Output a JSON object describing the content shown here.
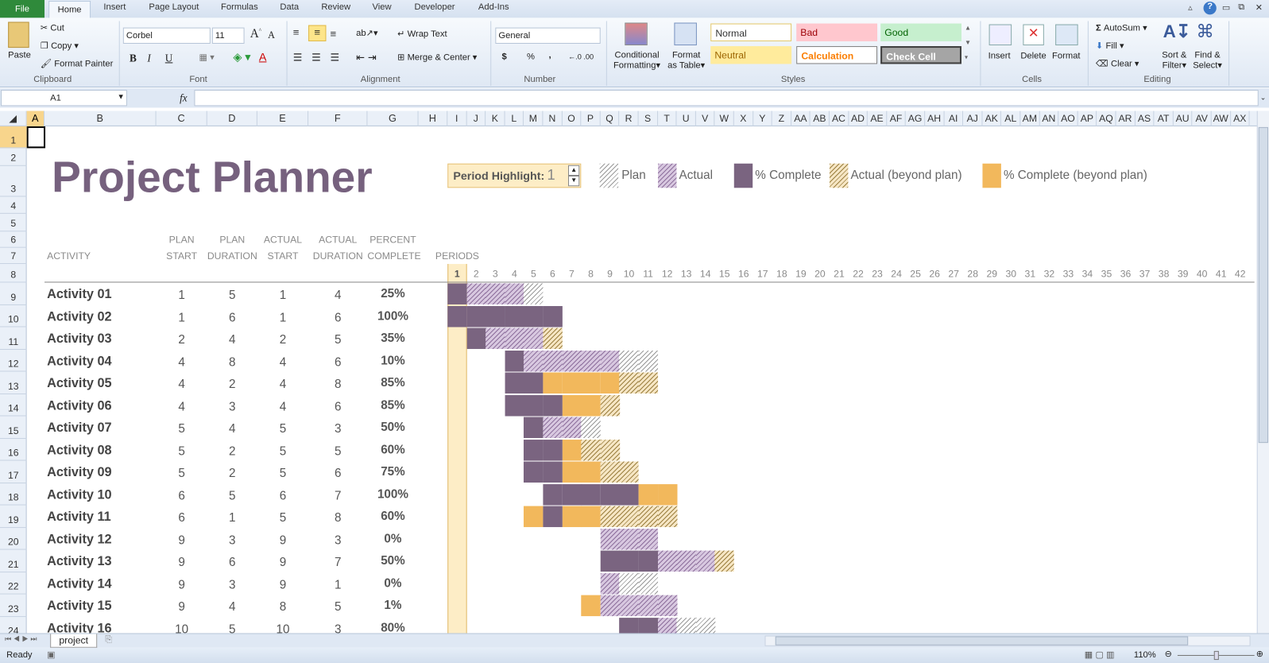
{
  "ribbon": {
    "file_tab": "File",
    "tabs": [
      "Home",
      "Insert",
      "Page Layout",
      "Formulas",
      "Data",
      "Review",
      "View",
      "Developer",
      "Add-Ins"
    ],
    "clipboard": {
      "paste": "Paste",
      "cut": "Cut",
      "copy": "Copy",
      "format_painter": "Format Painter",
      "group": "Clipboard"
    },
    "font": {
      "name": "Corbel",
      "size": "11",
      "group": "Font",
      "bold": "B",
      "italic": "I",
      "underline": "U"
    },
    "alignment": {
      "wrap": "Wrap Text",
      "merge": "Merge & Center",
      "group": "Alignment"
    },
    "number": {
      "format": "General",
      "currency": "$",
      "percent": "%",
      "comma": ",",
      "group": "Number"
    },
    "styles": {
      "conditional": "Conditional",
      "conditional2": "Formatting",
      "format_table": "Format",
      "format_table2": "as Table",
      "group": "Styles",
      "cells": [
        {
          "label": "Normal",
          "bg": "#ffffff",
          "fg": "#333333"
        },
        {
          "label": "Bad",
          "bg": "#ffc7ce",
          "fg": "#9c0006"
        },
        {
          "label": "Good",
          "bg": "#c6efce",
          "fg": "#006100"
        },
        {
          "label": "Neutral",
          "bg": "#ffeb9c",
          "fg": "#9c6500"
        },
        {
          "label": "Calculation",
          "bg": "#ffffff",
          "fg": "#fa7d00"
        },
        {
          "label": "Check Cell",
          "bg": "#a5a5a5",
          "fg": "#ffffff"
        }
      ]
    },
    "cells": {
      "insert": "Insert",
      "delete": "Delete",
      "format": "Format",
      "group": "Cells"
    },
    "editing": {
      "autosum": "AutoSum",
      "fill": "Fill",
      "clear": "Clear",
      "sort": "Sort &",
      "sort2": "Filter",
      "find": "Find &",
      "find2": "Select",
      "group": "Editing"
    }
  },
  "formula_bar": {
    "name_box": "A1",
    "fx": "fx",
    "formula": ""
  },
  "columns_left": [
    "A",
    "B",
    "C",
    "D",
    "E",
    "F",
    "G",
    "H"
  ],
  "columns_periods": [
    "I",
    "J",
    "K",
    "L",
    "M",
    "N",
    "O",
    "P",
    "Q",
    "R",
    "S",
    "T",
    "U",
    "V",
    "W",
    "X",
    "Y",
    "Z",
    "AA",
    "AB",
    "AC",
    "AD",
    "AE",
    "AF",
    "AG",
    "AH",
    "AI",
    "AJ",
    "AK",
    "AL",
    "AM",
    "AN",
    "AO",
    "AP",
    "AQ",
    "AR",
    "AS",
    "AT",
    "AU",
    "AV",
    "AW",
    "AX"
  ],
  "rows": [
    "1",
    "2",
    "3",
    "4",
    "5",
    "6",
    "7",
    "8",
    "9",
    "10",
    "11",
    "12",
    "13",
    "14",
    "15",
    "16",
    "17",
    "18",
    "19",
    "20",
    "21",
    "22",
    "23",
    "24"
  ],
  "sheet": {
    "title": "Project Planner",
    "period_highlight_label": "Period Highlight:",
    "period_highlight": 1,
    "legend": [
      "Plan",
      "Actual",
      "% Complete",
      "Actual (beyond plan)",
      "% Complete (beyond plan)"
    ],
    "headers": {
      "activity": "ACTIVITY",
      "plan_start": [
        "PLAN",
        "START"
      ],
      "plan_duration": [
        "PLAN",
        "DURATION"
      ],
      "actual_start": [
        "ACTUAL",
        "START"
      ],
      "actual_duration": [
        "ACTUAL",
        "DURATION"
      ],
      "percent_complete": [
        "PERCENT",
        "COMPLETE"
      ],
      "periods": "PERIODS"
    },
    "periods": [
      1,
      2,
      3,
      4,
      5,
      6,
      7,
      8,
      9,
      10,
      11,
      12,
      13,
      14,
      15,
      16,
      17,
      18,
      19,
      20,
      21,
      22,
      23,
      24,
      25,
      26,
      27,
      28,
      29,
      30,
      31,
      32,
      33,
      34,
      35,
      36,
      37,
      38,
      39,
      40,
      41,
      42
    ],
    "activities": [
      {
        "name": "Activity 01",
        "plan_start": 1,
        "plan_duration": 5,
        "actual_start": 1,
        "actual_duration": 4,
        "percent": "25%"
      },
      {
        "name": "Activity 02",
        "plan_start": 1,
        "plan_duration": 6,
        "actual_start": 1,
        "actual_duration": 6,
        "percent": "100%"
      },
      {
        "name": "Activity 03",
        "plan_start": 2,
        "plan_duration": 4,
        "actual_start": 2,
        "actual_duration": 5,
        "percent": "35%"
      },
      {
        "name": "Activity 04",
        "plan_start": 4,
        "plan_duration": 8,
        "actual_start": 4,
        "actual_duration": 6,
        "percent": "10%"
      },
      {
        "name": "Activity 05",
        "plan_start": 4,
        "plan_duration": 2,
        "actual_start": 4,
        "actual_duration": 8,
        "percent": "85%"
      },
      {
        "name": "Activity 06",
        "plan_start": 4,
        "plan_duration": 3,
        "actual_start": 4,
        "actual_duration": 6,
        "percent": "85%"
      },
      {
        "name": "Activity 07",
        "plan_start": 5,
        "plan_duration": 4,
        "actual_start": 5,
        "actual_duration": 3,
        "percent": "50%"
      },
      {
        "name": "Activity 08",
        "plan_start": 5,
        "plan_duration": 2,
        "actual_start": 5,
        "actual_duration": 5,
        "percent": "60%"
      },
      {
        "name": "Activity 09",
        "plan_start": 5,
        "plan_duration": 2,
        "actual_start": 5,
        "actual_duration": 6,
        "percent": "75%"
      },
      {
        "name": "Activity 10",
        "plan_start": 6,
        "plan_duration": 5,
        "actual_start": 6,
        "actual_duration": 7,
        "percent": "100%"
      },
      {
        "name": "Activity 11",
        "plan_start": 6,
        "plan_duration": 1,
        "actual_start": 5,
        "actual_duration": 8,
        "percent": "60%"
      },
      {
        "name": "Activity 12",
        "plan_start": 9,
        "plan_duration": 3,
        "actual_start": 9,
        "actual_duration": 3,
        "percent": "0%"
      },
      {
        "name": "Activity 13",
        "plan_start": 9,
        "plan_duration": 6,
        "actual_start": 9,
        "actual_duration": 7,
        "percent": "50%"
      },
      {
        "name": "Activity 14",
        "plan_start": 9,
        "plan_duration": 3,
        "actual_start": 9,
        "actual_duration": 1,
        "percent": "0%"
      },
      {
        "name": "Activity 15",
        "plan_start": 9,
        "plan_duration": 4,
        "actual_start": 8,
        "actual_duration": 5,
        "percent": "1%"
      },
      {
        "name": "Activity 16",
        "plan_start": 10,
        "plan_duration": 5,
        "actual_start": 10,
        "actual_duration": 3,
        "percent": "80%"
      }
    ]
  },
  "sheet_tab": "project",
  "status": {
    "ready": "Ready",
    "zoom": "110%"
  },
  "colors": {
    "complete": "#7a6480",
    "beyond": "#f2b85c",
    "highlight": "#fdedc6",
    "title": "#76617e"
  }
}
